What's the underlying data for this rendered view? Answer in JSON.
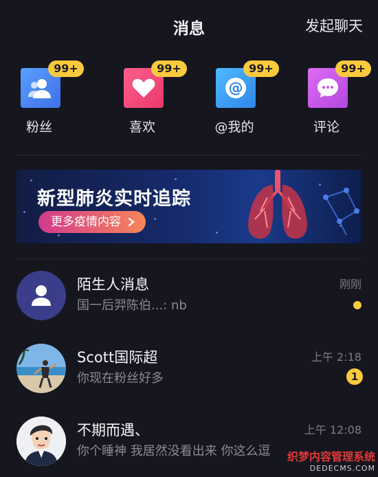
{
  "header": {
    "title": "消息",
    "action_label": "发起聊天"
  },
  "quick_actions": [
    {
      "label": "粉丝",
      "badge": "99+",
      "icon": "fans-icon",
      "color": "#4a8cf5"
    },
    {
      "label": "喜欢",
      "badge": "99+",
      "icon": "heart-icon",
      "color": "#f24a7a"
    },
    {
      "label": "@我的",
      "badge": "99+",
      "icon": "at-icon",
      "color": "#3aa5f5"
    },
    {
      "label": "评论",
      "badge": "99+",
      "icon": "comment-icon",
      "color": "#c957e8"
    }
  ],
  "banner": {
    "title": "新型肺炎实时追踪",
    "button_label": "更多疫情内容",
    "button_icon": "chevron-right-icon"
  },
  "messages": [
    {
      "name": "陌生人消息",
      "preview": "国一后羿陈伯...: nb",
      "time": "刚刚",
      "indicator": "dot",
      "avatar": "user-icon"
    },
    {
      "name": "Scott国际超",
      "preview": "你现在粉丝好多",
      "time": "上午 2:18",
      "unread": "1",
      "avatar": "beach-photo"
    },
    {
      "name": "不期而遇、",
      "preview": "你个睡神  我居然没看出来 你这么逗",
      "time": "上午 12:08",
      "avatar": "cartoon-man"
    }
  ],
  "watermark": {
    "line1": "织梦内容管理系统",
    "line2": "DEDECMS.COM"
  }
}
